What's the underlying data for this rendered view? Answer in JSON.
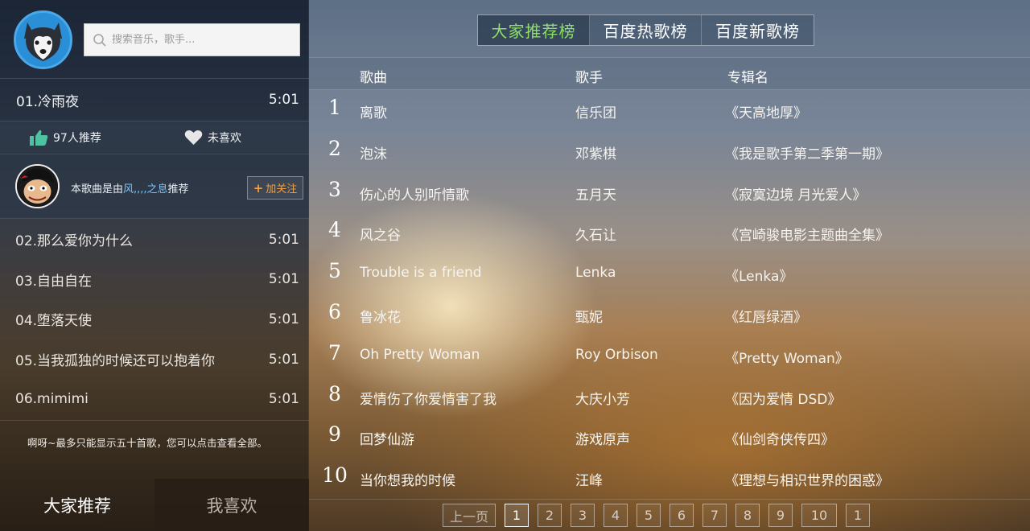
{
  "search": {
    "placeholder": "搜索音乐，歌手..."
  },
  "now_playing": {
    "title": "01.冷雨夜",
    "duration": "5:01"
  },
  "actions": {
    "recommend_count": "97人推荐",
    "like_status": "未喜欢"
  },
  "recommender": {
    "prefix": "本歌曲是由",
    "user": "风,,,,之息",
    "suffix": "推荐",
    "follow_label": "加关注"
  },
  "playlist": [
    {
      "title": "02.那么爱你为什么",
      "duration": "5:01"
    },
    {
      "title": "03.自由自在",
      "duration": "5:01"
    },
    {
      "title": "04.堕落天使",
      "duration": "5:01"
    },
    {
      "title": "05.当我孤独的时候还可以抱着你",
      "duration": "5:01"
    },
    {
      "title": "06.mimimi",
      "duration": "5:01"
    }
  ],
  "notice": "啊呀~最多只能显示五十首歌，您可以点击查看全部。",
  "bottom_tabs": [
    {
      "label": "大家推荐",
      "active": true
    },
    {
      "label": "我喜欢",
      "active": false
    }
  ],
  "chart_tabs": [
    {
      "label": "大家推荐榜",
      "active": true
    },
    {
      "label": "百度热歌榜",
      "active": false
    },
    {
      "label": "百度新歌榜",
      "active": false
    }
  ],
  "columns": {
    "song": "歌曲",
    "artist": "歌手",
    "album": "专辑名"
  },
  "songs": [
    {
      "rank": "1",
      "song": "离歌",
      "artist": "信乐团",
      "album": "《天高地厚》"
    },
    {
      "rank": "2",
      "song": "泡沫",
      "artist": "邓紫棋",
      "album": "《我是歌手第二季第一期》"
    },
    {
      "rank": "3",
      "song": "伤心的人别听情歌",
      "artist": "五月天",
      "album": "《寂寞边境 月光爱人》"
    },
    {
      "rank": "4",
      "song": "风之谷",
      "artist": "久石让",
      "album": "《宫崎骏电影主题曲全集》"
    },
    {
      "rank": "5",
      "song": "Trouble is a friend",
      "artist": "Lenka",
      "album": "《Lenka》"
    },
    {
      "rank": "6",
      "song": "鲁冰花",
      "artist": "甄妮",
      "album": "《红唇绿酒》"
    },
    {
      "rank": "7",
      "song": "Oh Pretty Woman",
      "artist": "Roy Orbison",
      "album": "《Pretty Woman》"
    },
    {
      "rank": "8",
      "song": "爱情伤了你爱情害了我",
      "artist": "大庆小芳",
      "album": "《因为爱情 DSD》"
    },
    {
      "rank": "9",
      "song": "回梦仙游",
      "artist": "游戏原声",
      "album": "《仙剑奇侠传四》"
    },
    {
      "rank": "10",
      "song": "当你想我的时候",
      "artist": "汪峰",
      "album": "《理想与相识世界的困惑》"
    }
  ],
  "pager": {
    "prev_label": "上一页",
    "pages": [
      "1",
      "2",
      "3",
      "4",
      "5",
      "6",
      "7",
      "8",
      "9",
      "10",
      "1"
    ],
    "current": "1"
  }
}
